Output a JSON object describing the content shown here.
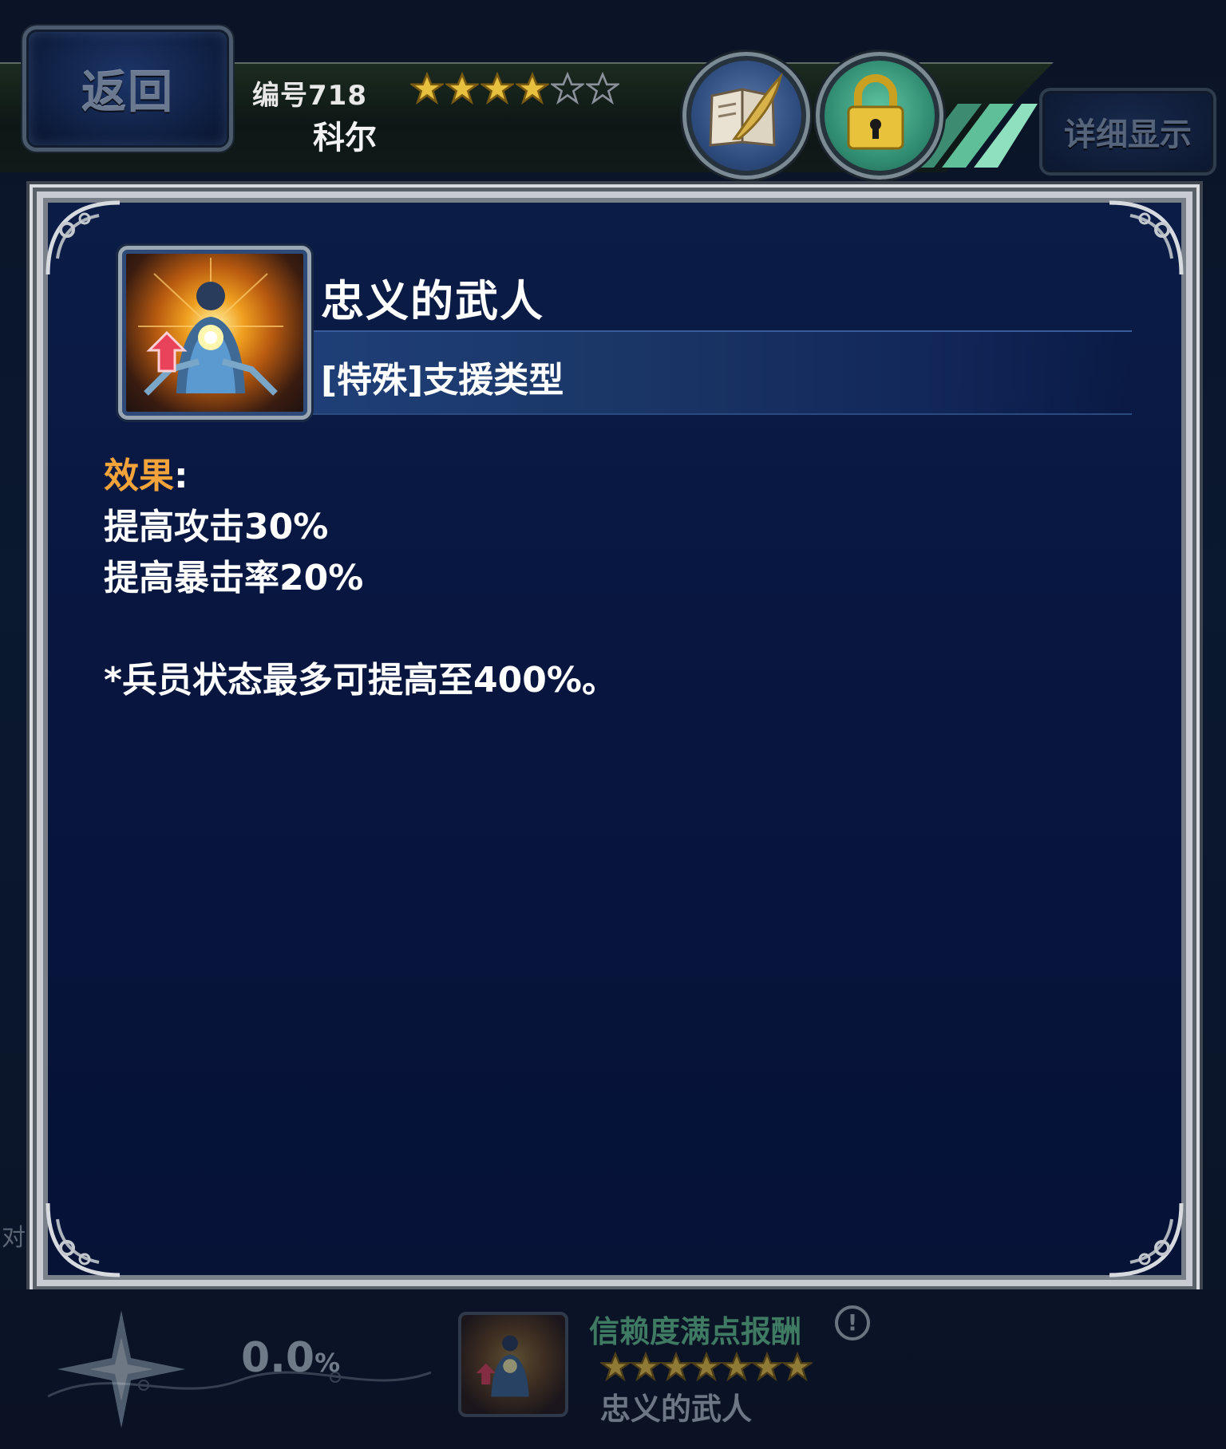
{
  "header": {
    "back_label": "返回",
    "unit_number": "编号718",
    "unit_name": "科尔",
    "rarity": {
      "filled": 4,
      "total": 6
    },
    "detail_label": "详细显示"
  },
  "skill": {
    "name": "忠义的武人",
    "type": "[特殊]支援类型",
    "effect_label": "效果",
    "effect_colon": ":",
    "effects": [
      "提高攻击30%",
      "提高暴击率20%"
    ],
    "note": "*兵员状态最多可提高至400%。"
  },
  "trust": {
    "percent_value": "0.0",
    "percent_sign": "%",
    "reward_title": "信赖度满点报酬",
    "reward_stars": 7,
    "reward_name": "忠义的武人"
  },
  "side": {
    "partial_text": "对"
  },
  "colors": {
    "accent_orange": "#f2a33a",
    "panel_blue": "#081640",
    "frame_silver": "#c8ccd2",
    "star_gold": "#e8c040",
    "lock_green": "#2f8a70"
  },
  "icons": [
    "journal-icon",
    "lock-icon",
    "star-icon",
    "info-icon",
    "compass-icon",
    "skill-aura-icon"
  ]
}
